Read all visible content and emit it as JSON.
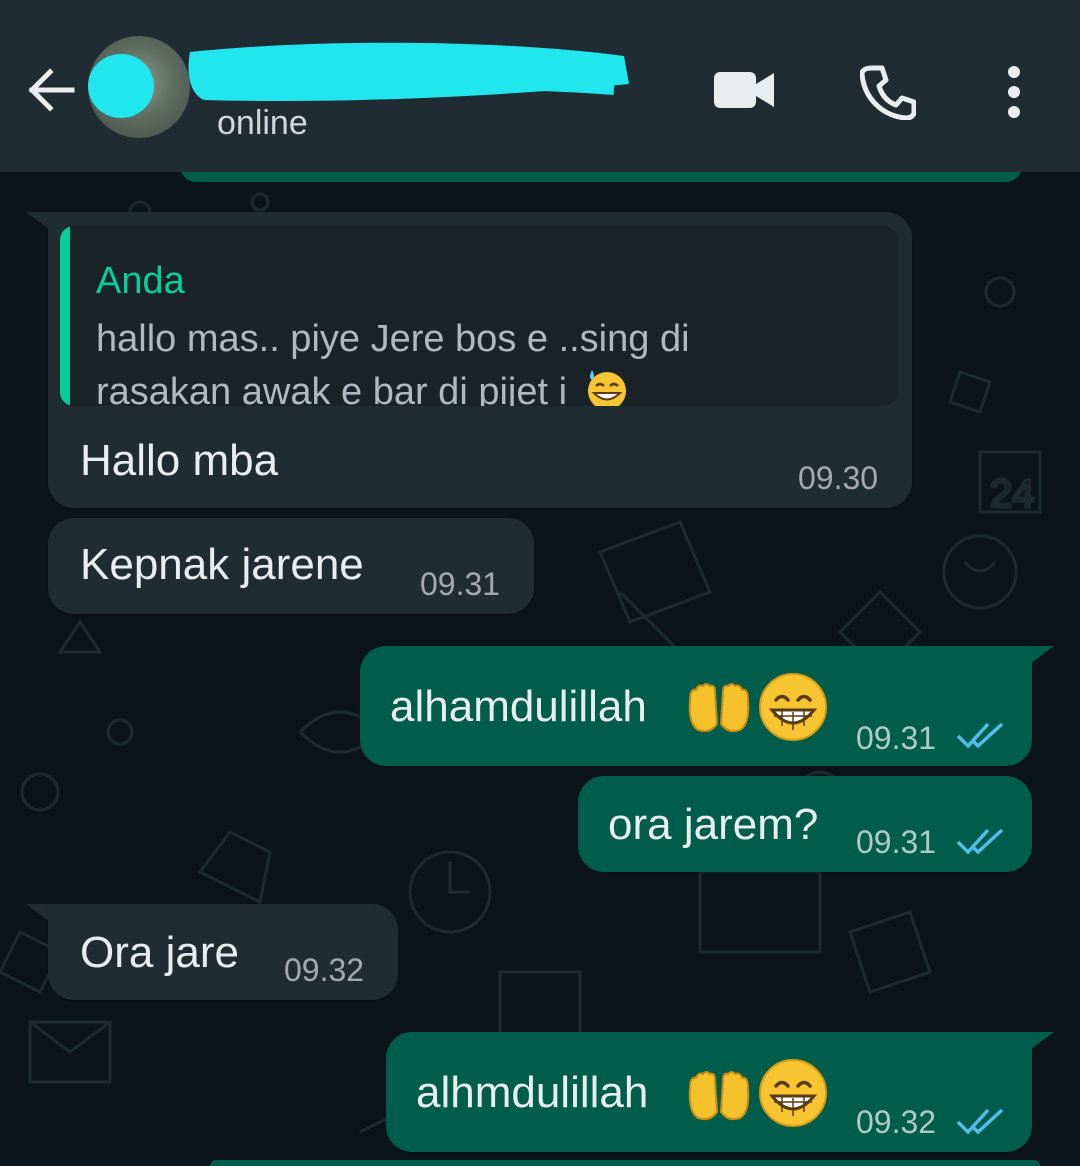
{
  "header": {
    "contact_name": "...",
    "status": "online",
    "icons": [
      "back-arrow-icon",
      "video-call-icon",
      "voice-call-icon",
      "more-options-icon"
    ]
  },
  "colors": {
    "header_bg": "#202c33",
    "chat_bg": "#0b141a",
    "incoming_bubble": "#202c33",
    "outgoing_bubble": "#005c4b",
    "accent": "#06cf9c",
    "read_tick": "#53bdeb"
  },
  "messages": [
    {
      "direction": "incoming",
      "quoted": {
        "author": "Anda",
        "line1": "hallo mas..  piye Jere bos e ..sing di",
        "line2": "rasakan awak e bar di pijet i",
        "emoji": "grinning-sweat-emoji"
      },
      "text": "Hallo mba",
      "time": "09.30"
    },
    {
      "direction": "incoming",
      "text": "Kepnak jarene",
      "time": "09.31"
    },
    {
      "direction": "outgoing",
      "text": "alhamdulillah",
      "emojis": [
        "palms-up-together-emoji",
        "beaming-face-emoji"
      ],
      "time": "09.31",
      "status": "read"
    },
    {
      "direction": "outgoing",
      "text": "ora jarem?",
      "time": "09.31",
      "status": "read"
    },
    {
      "direction": "incoming",
      "text": "Ora jare",
      "time": "09.32"
    },
    {
      "direction": "outgoing",
      "text": "alhmdulillah",
      "emojis": [
        "palms-up-together-emoji",
        "beaming-face-emoji"
      ],
      "time": "09.32",
      "status": "read"
    }
  ]
}
